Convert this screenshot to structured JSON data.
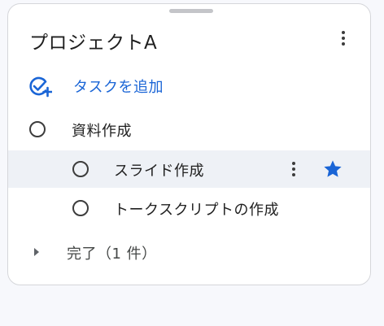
{
  "list": {
    "title": "プロジェクトA"
  },
  "add_task": {
    "label": "タスクを追加"
  },
  "tasks": [
    {
      "label": "資料作成",
      "subtask": false,
      "starred": false
    },
    {
      "label": "スライド作成",
      "subtask": true,
      "starred": true,
      "selected": true
    },
    {
      "label": "トークスクリプトの作成",
      "subtask": true,
      "starred": false
    }
  ],
  "completed": {
    "label": "完了（1 件）"
  },
  "colors": {
    "accent": "#1a65d6",
    "star": "#1a65d6",
    "highlight_row": "#eef1f6"
  },
  "icons": {
    "header_menu": "more-vert-icon",
    "add_task": "add-task-icon",
    "row_menu": "more-vert-icon",
    "star": "star-icon",
    "expand": "caret-right-icon"
  }
}
